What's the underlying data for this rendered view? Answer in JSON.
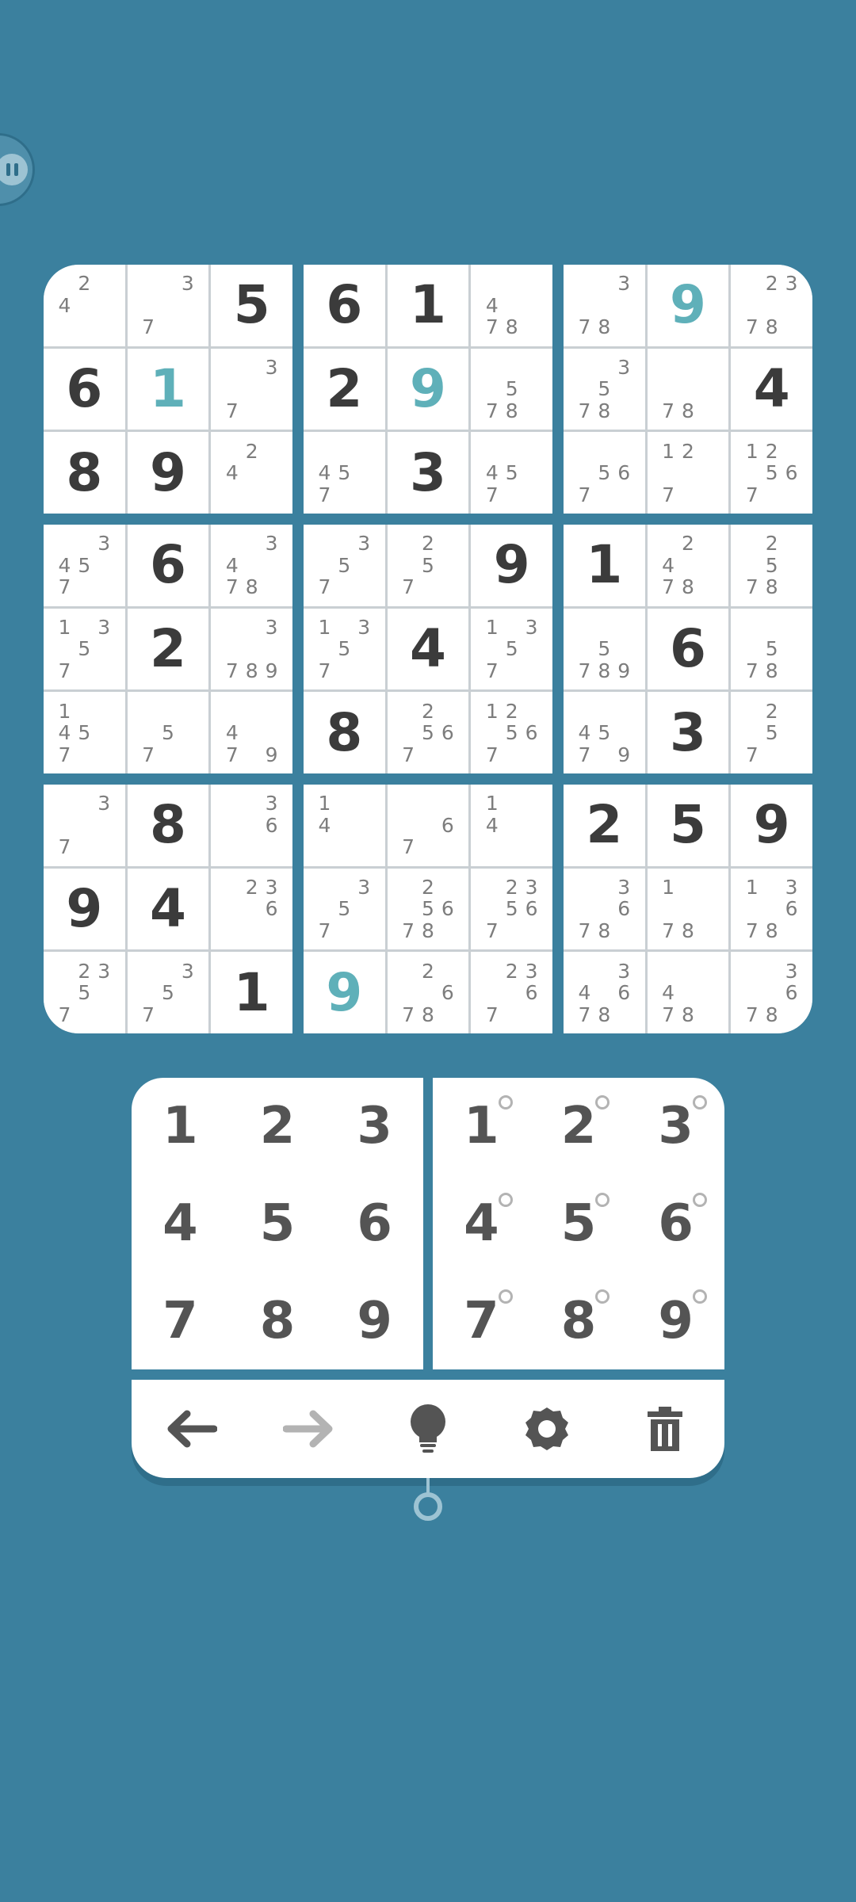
{
  "board": [
    [
      "",
      "",
      "5",
      "",
      "",
      "",
      "",
      "",
      "",
      "6",
      "",
      "",
      "",
      "",
      "",
      "",
      "",
      "",
      "8",
      "9",
      ""
    ],
    [
      ""
    ]
  ],
  "boxes": [
    {
      "corner": "tl",
      "cells": [
        {
          "notes": [
            "",
            "2",
            "",
            "4",
            "",
            "",
            "",
            "",
            ""
          ]
        },
        {
          "notes": [
            "",
            "",
            "3",
            "",
            "",
            "",
            "7",
            "",
            ""
          ]
        },
        {
          "value": "5"
        },
        {
          "value": "6"
        },
        {
          "value": "1",
          "user": true
        },
        {
          "notes": [
            "",
            "",
            "3",
            "",
            "",
            "",
            "7",
            "",
            ""
          ]
        },
        {
          "value": "8"
        },
        {
          "value": "9"
        },
        {
          "notes": [
            "",
            "2",
            "",
            "4",
            "",
            "",
            "",
            "",
            ""
          ]
        }
      ]
    },
    {
      "corner": "",
      "cells": [
        {
          "value": "6"
        },
        {
          "value": "1"
        },
        {
          "notes": [
            "",
            "",
            "",
            "4",
            "",
            "",
            "7",
            "8",
            ""
          ]
        },
        {
          "value": "2"
        },
        {
          "value": "9",
          "user": true
        },
        {
          "notes": [
            "",
            "",
            "",
            "",
            "5",
            "",
            "7",
            "8",
            ""
          ]
        },
        {
          "notes": [
            "",
            "",
            "",
            "4",
            "5",
            "",
            "7",
            "",
            ""
          ]
        },
        {
          "value": "3"
        },
        {
          "notes": [
            "",
            "",
            "",
            "4",
            "5",
            "",
            "7",
            "",
            ""
          ]
        }
      ]
    },
    {
      "corner": "tr",
      "cells": [
        {
          "notes": [
            "",
            "",
            "3",
            "",
            "",
            "",
            "7",
            "8",
            ""
          ]
        },
        {
          "value": "9",
          "user": true
        },
        {
          "notes": [
            "",
            "2",
            "3",
            "",
            "",
            "",
            "7",
            "8",
            ""
          ]
        },
        {
          "notes": [
            "",
            "",
            "3",
            "",
            "5",
            "",
            "7",
            "8",
            ""
          ]
        },
        {
          "notes": [
            "",
            "",
            "",
            "",
            "",
            "",
            "7",
            "8",
            ""
          ]
        },
        {
          "value": "4"
        },
        {
          "notes": [
            "",
            "",
            "",
            "",
            "5",
            "6",
            "7",
            "",
            ""
          ]
        },
        {
          "notes": [
            "1",
            "2",
            "",
            "",
            "",
            "",
            "7",
            "",
            ""
          ]
        },
        {
          "notes": [
            "1",
            "2",
            "",
            "",
            "5",
            "6",
            "7",
            "",
            ""
          ]
        }
      ]
    },
    {
      "corner": "",
      "cells": [
        {
          "notes": [
            "",
            "",
            "3",
            "4",
            "5",
            "",
            "7",
            "",
            ""
          ]
        },
        {
          "value": "6"
        },
        {
          "notes": [
            "",
            "",
            "3",
            "4",
            "",
            "",
            "7",
            "8",
            ""
          ]
        },
        {
          "notes": [
            "1",
            "",
            "3",
            "",
            "5",
            "",
            "7",
            "",
            ""
          ]
        },
        {
          "value": "2"
        },
        {
          "notes": [
            "",
            "",
            "3",
            "",
            "",
            "",
            "7",
            "8",
            "9"
          ]
        },
        {
          "notes": [
            "1",
            "",
            "",
            "4",
            "5",
            "",
            "7",
            "",
            ""
          ]
        },
        {
          "notes": [
            "",
            "",
            "",
            "",
            "5",
            "",
            "7",
            "",
            ""
          ]
        },
        {
          "notes": [
            "",
            "",
            "",
            "4",
            "",
            "",
            "7",
            "",
            "9"
          ]
        }
      ]
    },
    {
      "corner": "",
      "cells": [
        {
          "notes": [
            "",
            "",
            "3",
            "",
            "5",
            "",
            "7",
            "",
            ""
          ]
        },
        {
          "notes": [
            "",
            "2",
            "",
            "",
            "5",
            "",
            "7",
            "",
            ""
          ]
        },
        {
          "value": "9"
        },
        {
          "notes": [
            "1",
            "",
            "3",
            "",
            "5",
            "",
            "7",
            "",
            ""
          ]
        },
        {
          "value": "4"
        },
        {
          "notes": [
            "1",
            "",
            "3",
            "",
            "5",
            "",
            "7",
            "",
            ""
          ]
        },
        {
          "value": "8"
        },
        {
          "notes": [
            "",
            "2",
            "",
            "",
            "5",
            "6",
            "7",
            "",
            ""
          ]
        },
        {
          "notes": [
            "1",
            "2",
            "",
            "",
            "5",
            "6",
            "7",
            "",
            ""
          ]
        }
      ]
    },
    {
      "corner": "",
      "cells": [
        {
          "value": "1"
        },
        {
          "notes": [
            "",
            "2",
            "",
            "4",
            "",
            "",
            "7",
            "8",
            ""
          ]
        },
        {
          "notes": [
            "",
            "2",
            "",
            "",
            "5",
            "",
            "7",
            "8",
            ""
          ]
        },
        {
          "notes": [
            "",
            "",
            "",
            "",
            "5",
            "",
            "7",
            "8",
            "9"
          ]
        },
        {
          "value": "6"
        },
        {
          "notes": [
            "",
            "",
            "",
            "",
            "5",
            "",
            "7",
            "8",
            ""
          ]
        },
        {
          "notes": [
            "",
            "",
            "",
            "4",
            "5",
            "",
            "7",
            "",
            "9"
          ]
        },
        {
          "value": "3"
        },
        {
          "notes": [
            "",
            "2",
            "",
            "",
            "5",
            "",
            "7",
            "",
            ""
          ]
        }
      ]
    },
    {
      "corner": "bl",
      "cells": [
        {
          "notes": [
            "",
            "",
            "3",
            "",
            "",
            "",
            "7",
            "",
            ""
          ]
        },
        {
          "value": "8"
        },
        {
          "notes": [
            "",
            "",
            "3",
            "",
            "",
            "6",
            "",
            "",
            ""
          ]
        },
        {
          "value": "9"
        },
        {
          "value": "4"
        },
        {
          "notes": [
            "",
            "2",
            "3",
            "",
            "",
            "6",
            "",
            "",
            ""
          ]
        },
        {
          "notes": [
            "",
            "2",
            "3",
            "",
            "5",
            "",
            "7",
            "",
            ""
          ]
        },
        {
          "notes": [
            "",
            "",
            "3",
            "",
            "5",
            "",
            "7",
            "",
            ""
          ]
        },
        {
          "value": "1"
        }
      ]
    },
    {
      "corner": "",
      "cells": [
        {
          "notes": [
            "1",
            "",
            "",
            "4",
            "",
            "",
            "",
            "",
            ""
          ]
        },
        {
          "notes": [
            "",
            "",
            "",
            "",
            "",
            "6",
            "7",
            "",
            ""
          ]
        },
        {
          "notes": [
            "1",
            "",
            "",
            "4",
            "",
            "",
            "",
            "",
            ""
          ]
        },
        {
          "notes": [
            "",
            "",
            "3",
            "",
            "5",
            "",
            "7",
            "",
            ""
          ]
        },
        {
          "notes": [
            "",
            "2",
            "",
            "",
            "5",
            "6",
            "7",
            "8",
            ""
          ]
        },
        {
          "notes": [
            "",
            "2",
            "3",
            "",
            "5",
            "6",
            "7",
            "",
            ""
          ]
        },
        {
          "value": "9",
          "user": true
        },
        {
          "notes": [
            "",
            "2",
            "",
            "",
            "",
            "6",
            "7",
            "8",
            ""
          ]
        },
        {
          "notes": [
            "",
            "2",
            "3",
            "",
            "",
            "6",
            "7",
            "",
            ""
          ]
        }
      ]
    },
    {
      "corner": "br",
      "cells": [
        {
          "value": "2"
        },
        {
          "value": "5"
        },
        {
          "value": "9"
        },
        {
          "notes": [
            "",
            "",
            "3",
            "",
            "",
            "6",
            "7",
            "8",
            ""
          ]
        },
        {
          "notes": [
            "1",
            "",
            "",
            "",
            "",
            "",
            "7",
            "8",
            ""
          ]
        },
        {
          "notes": [
            "1",
            "",
            "3",
            "",
            "",
            "6",
            "7",
            "8",
            ""
          ]
        },
        {
          "notes": [
            "",
            "",
            "3",
            "4",
            "",
            "6",
            "7",
            "8",
            ""
          ]
        },
        {
          "notes": [
            "",
            "",
            "",
            "4",
            "",
            "",
            "7",
            "8",
            ""
          ]
        },
        {
          "notes": [
            "",
            "",
            "3",
            "",
            "",
            "6",
            "7",
            "8",
            ""
          ]
        }
      ]
    }
  ],
  "number_pad": [
    "1",
    "2",
    "3",
    "4",
    "5",
    "6",
    "7",
    "8",
    "9"
  ],
  "notes_pad": [
    "1",
    "2",
    "3",
    "4",
    "5",
    "6",
    "7",
    "8",
    "9"
  ],
  "toolbar": {
    "undo_icon": "arrow-left-icon",
    "redo_icon": "arrow-right-icon",
    "hint_icon": "lightbulb-icon",
    "settings_icon": "gear-icon",
    "delete_icon": "trash-icon",
    "active_color": "#545454",
    "disabled_color": "#b3b3b3"
  },
  "colors": {
    "background": "#3b809e",
    "given_digit": "#3b3b3b",
    "user_digit": "#5fb0b9",
    "note_digit": "#7d7d7d"
  }
}
